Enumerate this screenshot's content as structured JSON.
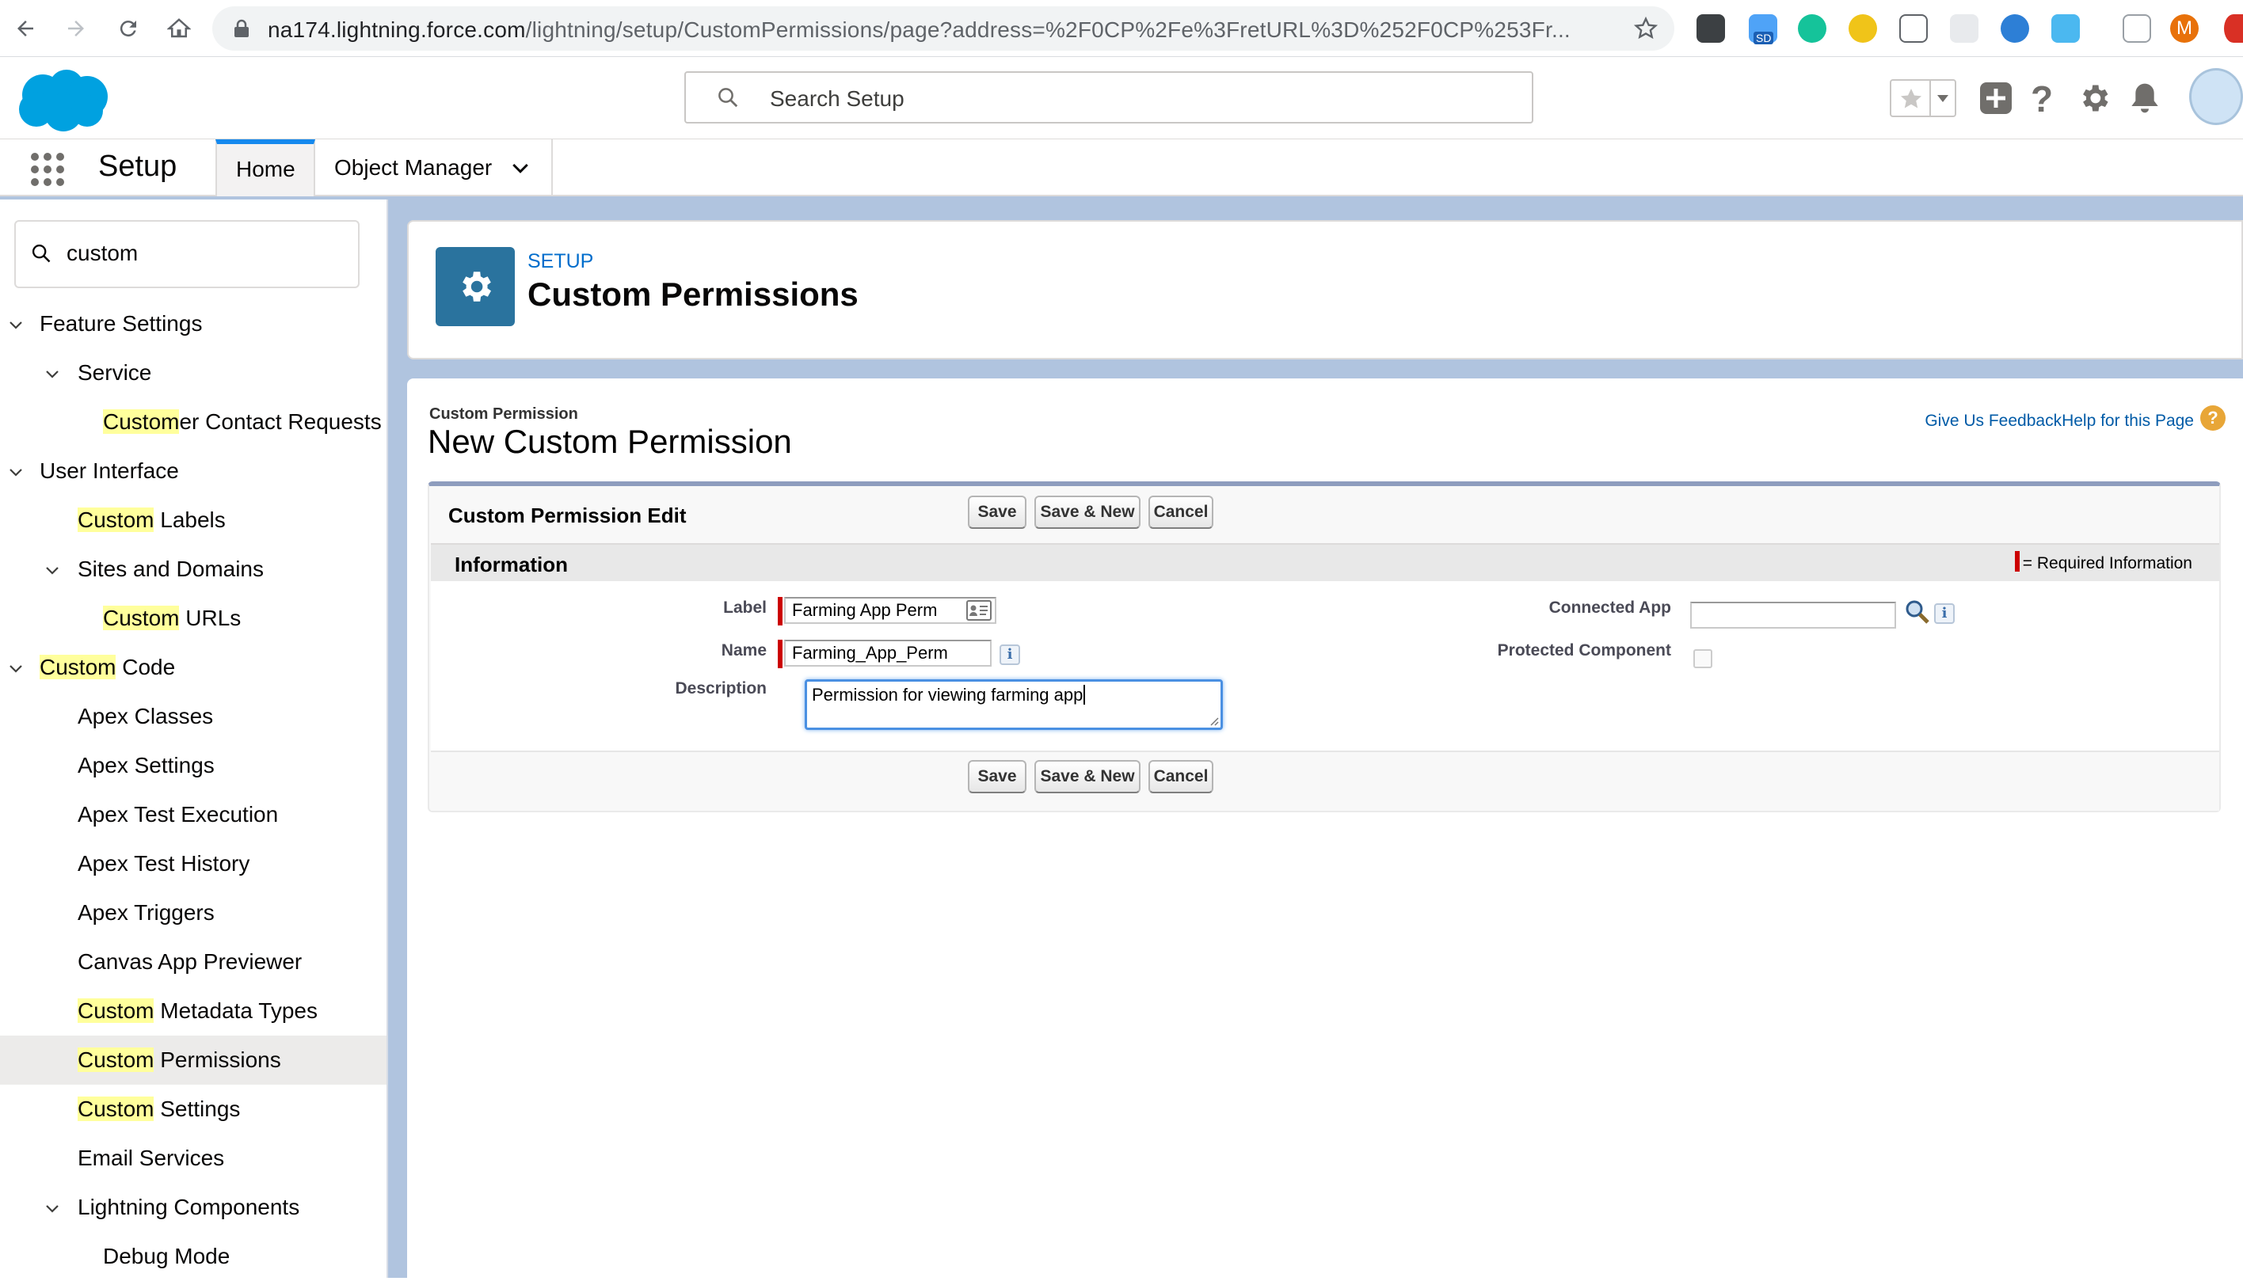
{
  "browser": {
    "url_host": "na174.lightning.force.com",
    "url_path": "/lightning/setup/CustomPermissions/page?address=%2F0CP%2Fe%3FretURL%3D%252F0CP%253Fr...",
    "profile_initial": "M",
    "extension_badge": "SD"
  },
  "global_header": {
    "search_placeholder": "Search Setup"
  },
  "app_nav": {
    "app_name": "Setup",
    "tabs": [
      {
        "label": "Home",
        "active": true
      },
      {
        "label": "Object Manager",
        "active": false
      }
    ]
  },
  "sidebar": {
    "quick_find_value": "custom",
    "items": [
      {
        "pre": "",
        "hl": "",
        "post": "Feature Settings",
        "level": 0,
        "expandable": true,
        "selected": false
      },
      {
        "pre": "",
        "hl": "",
        "post": "Service",
        "level": 1,
        "expandable": true,
        "selected": false
      },
      {
        "pre": "",
        "hl": "Custom",
        "post": "er Contact Requests",
        "level": 2,
        "expandable": false,
        "selected": false
      },
      {
        "pre": "",
        "hl": "",
        "post": "User Interface",
        "level": 0,
        "expandable": true,
        "selected": false
      },
      {
        "pre": "",
        "hl": "Custom",
        "post": " Labels",
        "level": 1,
        "expandable": false,
        "selected": false
      },
      {
        "pre": "",
        "hl": "",
        "post": "Sites and Domains",
        "level": 1,
        "expandable": true,
        "selected": false
      },
      {
        "pre": "",
        "hl": "Custom",
        "post": " URLs",
        "level": 2,
        "expandable": false,
        "selected": false
      },
      {
        "pre": "",
        "hl": "Custom",
        "post": " Code",
        "level": 0,
        "expandable": true,
        "selected": false
      },
      {
        "pre": "",
        "hl": "",
        "post": "Apex Classes",
        "level": 1,
        "expandable": false,
        "selected": false
      },
      {
        "pre": "",
        "hl": "",
        "post": "Apex Settings",
        "level": 1,
        "expandable": false,
        "selected": false
      },
      {
        "pre": "",
        "hl": "",
        "post": "Apex Test Execution",
        "level": 1,
        "expandable": false,
        "selected": false
      },
      {
        "pre": "",
        "hl": "",
        "post": "Apex Test History",
        "level": 1,
        "expandable": false,
        "selected": false
      },
      {
        "pre": "",
        "hl": "",
        "post": "Apex Triggers",
        "level": 1,
        "expandable": false,
        "selected": false
      },
      {
        "pre": "",
        "hl": "",
        "post": "Canvas App Previewer",
        "level": 1,
        "expandable": false,
        "selected": false
      },
      {
        "pre": "",
        "hl": "Custom",
        "post": " Metadata Types",
        "level": 1,
        "expandable": false,
        "selected": false
      },
      {
        "pre": "",
        "hl": "Custom",
        "post": " Permissions",
        "level": 1,
        "expandable": false,
        "selected": true
      },
      {
        "pre": "",
        "hl": "Custom",
        "post": " Settings",
        "level": 1,
        "expandable": false,
        "selected": false
      },
      {
        "pre": "",
        "hl": "",
        "post": "Email Services",
        "level": 1,
        "expandable": false,
        "selected": false
      },
      {
        "pre": "",
        "hl": "",
        "post": "Lightning Components",
        "level": 1,
        "expandable": true,
        "selected": false
      },
      {
        "pre": "",
        "hl": "",
        "post": "Debug Mode",
        "level": 2,
        "expandable": false,
        "selected": false
      }
    ]
  },
  "setup_header": {
    "eyebrow": "SETUP",
    "title": "Custom Permissions"
  },
  "page": {
    "breadcrumb": "Custom Permission",
    "title": "New Custom Permission",
    "help_link": "Give Us FeedbackHelp for this Page",
    "help_icon": "?"
  },
  "edit_block": {
    "title": "Custom Permission Edit",
    "buttons": {
      "save": "Save",
      "save_new": "Save & New",
      "cancel": "Cancel"
    },
    "section_title": "Information",
    "required_legend": "= Required Information",
    "fields": {
      "label": {
        "label": "Label",
        "value": "Farming App Perm"
      },
      "name": {
        "label": "Name",
        "value": "Farming_App_Perm"
      },
      "description": {
        "label": "Description",
        "value": "Permission for viewing farming app"
      },
      "connected_app": {
        "label": "Connected App",
        "value": ""
      },
      "protected_component": {
        "label": "Protected Component",
        "checked": false
      }
    },
    "info_glyph": "i"
  },
  "colors": {
    "brand_blue": "#00a1e0",
    "setup_icon_bg": "#2a739e",
    "highlight": "#ffff9c",
    "required_red": "#cc0000",
    "link_blue": "#015ba7"
  }
}
